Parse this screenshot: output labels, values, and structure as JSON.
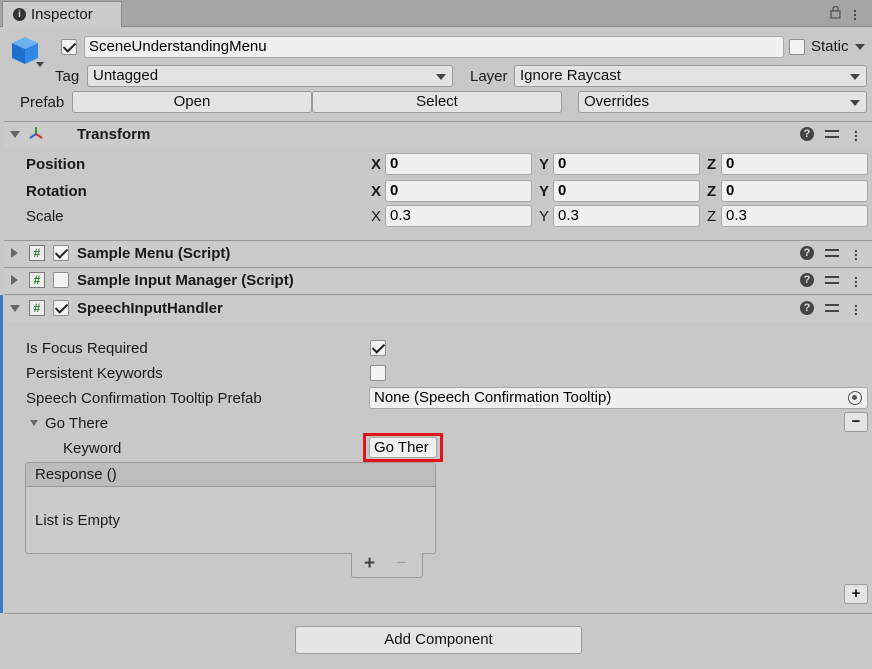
{
  "tab": {
    "title": "Inspector"
  },
  "object": {
    "name": "SceneUnderstandingMenu",
    "active": true,
    "static_label": "Static",
    "tag_label": "Tag",
    "tag_value": "Untagged",
    "layer_label": "Layer",
    "layer_value": "Ignore Raycast"
  },
  "prefab": {
    "label": "Prefab",
    "open_label": "Open",
    "select_label": "Select",
    "overrides_label": "Overrides"
  },
  "transform": {
    "title": "Transform",
    "position": {
      "label": "Position",
      "x": "0",
      "y": "0",
      "z": "0"
    },
    "rotation": {
      "label": "Rotation",
      "x": "0",
      "y": "0",
      "z": "0"
    },
    "scale": {
      "label": "Scale",
      "x": "0.3",
      "y": "0.3",
      "z": "0.3"
    },
    "axis_x": "X",
    "axis_y": "Y",
    "axis_z": "Z"
  },
  "components": [
    {
      "title": "Sample Menu (Script)",
      "enabled": true
    },
    {
      "title": "Sample Input Manager (Script)",
      "enabled": false
    },
    {
      "title": "SpeechInputHandler",
      "enabled": true
    }
  ],
  "speech": {
    "focus_label": "Is Focus Required",
    "focus_value": true,
    "persistent_label": "Persistent Keywords",
    "persistent_value": false,
    "tooltip_label": "Speech Confirmation Tooltip Prefab",
    "tooltip_value": "None (Speech Confirmation Tooltip)",
    "entry_label": "Go There",
    "keyword_label": "Keyword",
    "keyword_value": "Go Ther",
    "response_label": "Response ()",
    "list_empty": "List is Empty",
    "add_symbol": "+",
    "remove_symbol": "−"
  },
  "footer": {
    "add_component": "Add Component"
  },
  "colors": {
    "highlight": "#e0141b",
    "accent_blue": "#3a78c8"
  }
}
